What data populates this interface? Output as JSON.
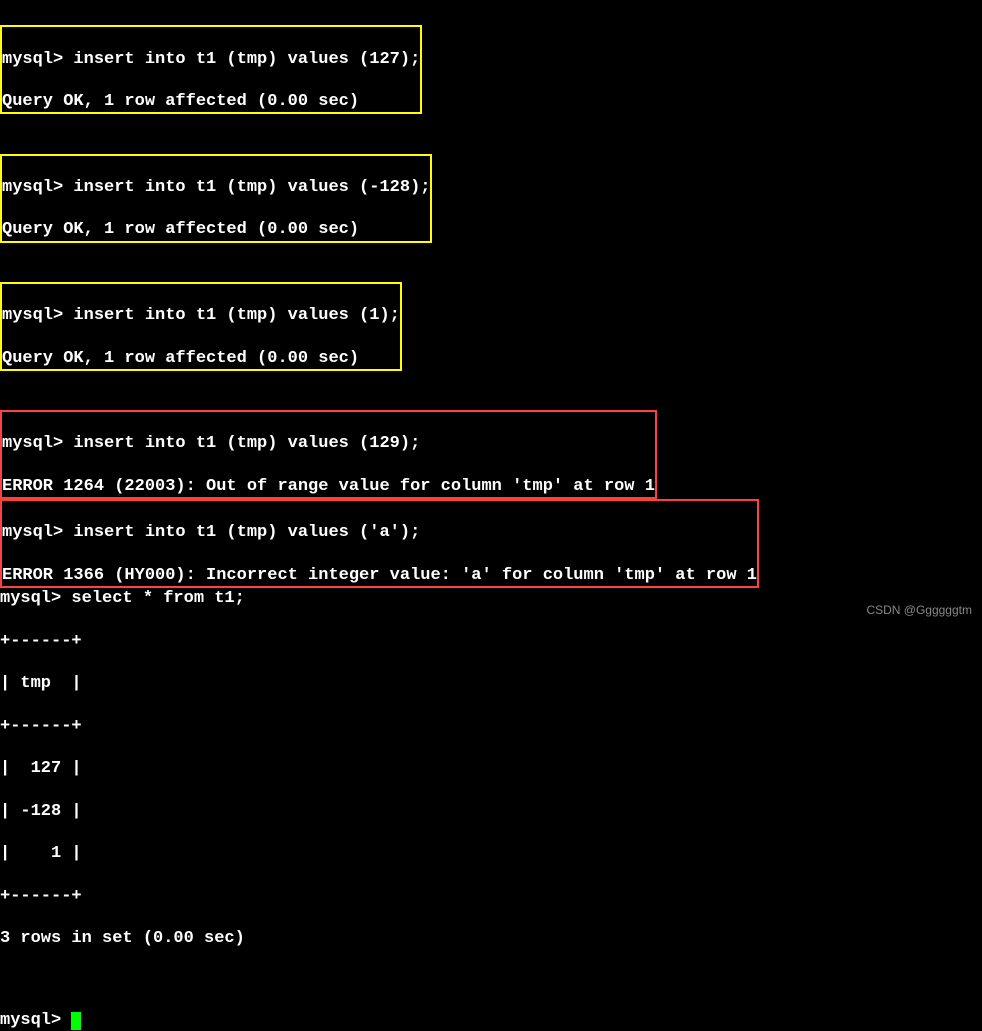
{
  "blocks": {
    "block1": {
      "cmd": "mysql> insert into t1 (tmp) values (127);",
      "resp": "Query OK, 1 row affected (0.00 sec)"
    },
    "block2": {
      "cmd": "mysql> insert into t1 (tmp) values (-128);",
      "resp": "Query OK, 1 row affected (0.00 sec)"
    },
    "block3": {
      "cmd": "mysql> insert into t1 (tmp) values (1);",
      "resp": "Query OK, 1 row affected (0.00 sec)"
    },
    "block4": {
      "cmd": "mysql> insert into t1 (tmp) values (129);",
      "resp": "ERROR 1264 (22003): Out of range value for column 'tmp' at row 1"
    },
    "block5": {
      "cmd": "mysql> insert into t1 (tmp) values ('a');",
      "resp": "ERROR 1366 (HY000): Incorrect integer value: 'a' for column 'tmp' at row 1"
    }
  },
  "select": {
    "cmd": "mysql> select * from t1;",
    "sep": "+------+",
    "header": "| tmp  |",
    "row1": "|  127 |",
    "row2": "| -128 |",
    "row3": "|    1 |",
    "summary": "3 rows in set (0.00 sec)"
  },
  "prompt": "mysql> ",
  "watermark": "CSDN @Ggggggtm",
  "chart_data": {
    "type": "table",
    "title": "t1",
    "columns": [
      "tmp"
    ],
    "rows": [
      [
        127
      ],
      [
        -128
      ],
      [
        1
      ]
    ],
    "row_count": 3
  }
}
